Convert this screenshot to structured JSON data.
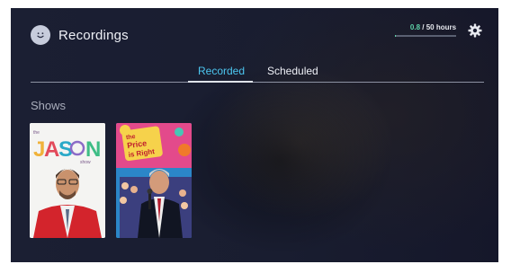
{
  "header": {
    "title": "Recordings",
    "avatar_icon": "smiley-avatar-icon"
  },
  "storage": {
    "used": "0.8",
    "total": "/ 50 hours",
    "used_fraction": 0.016,
    "accent_color": "#5ed3a9"
  },
  "settings_icon": "gear-icon",
  "tabs": [
    {
      "label": "Recorded",
      "active": true
    },
    {
      "label": "Scheduled",
      "active": false
    }
  ],
  "accent_color": "#4cc6f0",
  "shows": {
    "title": "Shows",
    "items": [
      {
        "name": "the-jason-show",
        "logo_text": "the JAS N show"
      },
      {
        "name": "the-price-is-right",
        "logo_text": "the Price is Right"
      }
    ]
  }
}
